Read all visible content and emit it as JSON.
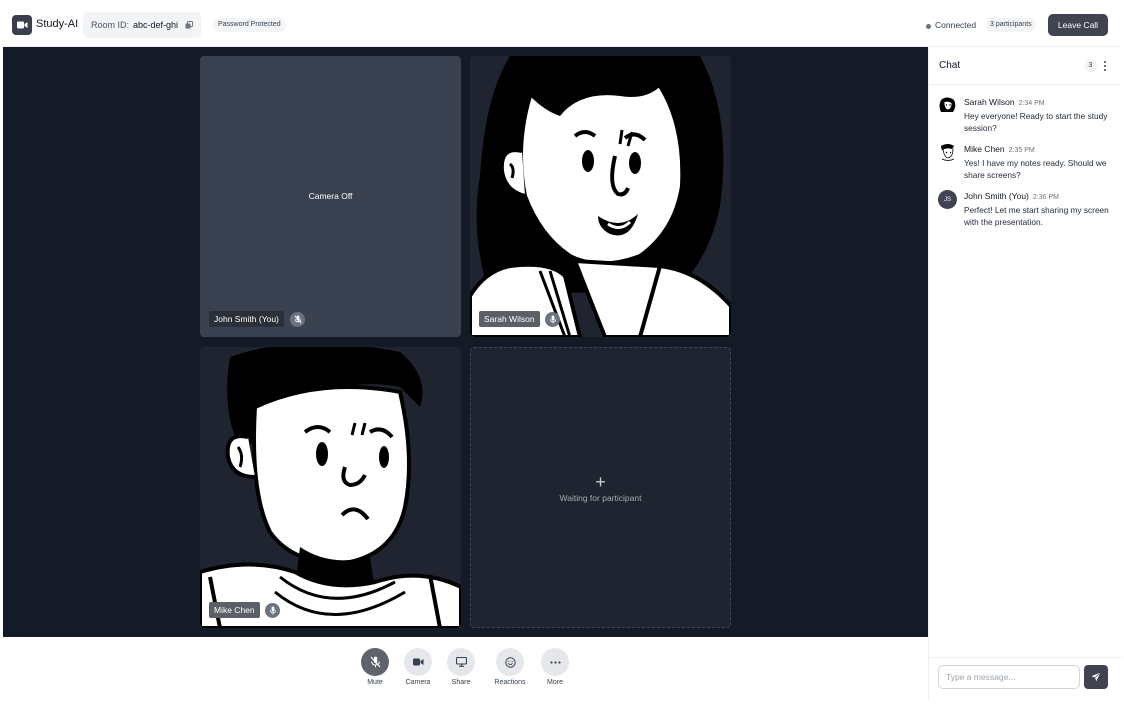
{
  "header": {
    "app_name": "Study-AI",
    "room_label": "Room ID:",
    "room_id": "abc-def-ghi",
    "password_badge": "Password Protected",
    "status_text": "Connected",
    "participants_badge": "3 participants",
    "leave_label": "Leave Call",
    "leave_color": "#3f4450"
  },
  "tiles": [
    {
      "name": "John Smith (You)",
      "state_text": "Camera Off",
      "muted": true
    },
    {
      "name": "Sarah Wilson",
      "muted": false
    },
    {
      "name": "Mike Chen",
      "muted": false
    },
    {
      "waiting_icon": "+",
      "waiting_text": "Waiting for participant"
    }
  ],
  "controls": [
    {
      "label": "Mute",
      "icon": "mic-off-icon",
      "active": true
    },
    {
      "label": "Camera",
      "icon": "camera-icon"
    },
    {
      "label": "Share",
      "icon": "monitor-icon"
    },
    {
      "label": "Reactions",
      "icon": "smile-icon"
    },
    {
      "label": "More",
      "icon": "ellipsis-icon"
    }
  ],
  "chat": {
    "title": "Chat",
    "count": "3",
    "messages": [
      {
        "author": "Sarah Wilson",
        "time": "2:34 PM",
        "text": "Hey everyone! Ready to start the study session?"
      },
      {
        "author": "Mike Chen",
        "time": "2:35 PM",
        "text": "Yes! I have my notes ready. Should we share screens?"
      },
      {
        "author": "John Smith (You)",
        "time": "2:36 PM",
        "text": "Perfect! Let me start sharing my screen with the presentation.",
        "initials": "JS"
      }
    ],
    "input_placeholder": "Type a message..."
  },
  "colors": {
    "stage_bg": "#141a26",
    "tile_bg": "#1f2430",
    "camera_off_bg": "#3a4150",
    "accent": "#3f4450"
  }
}
